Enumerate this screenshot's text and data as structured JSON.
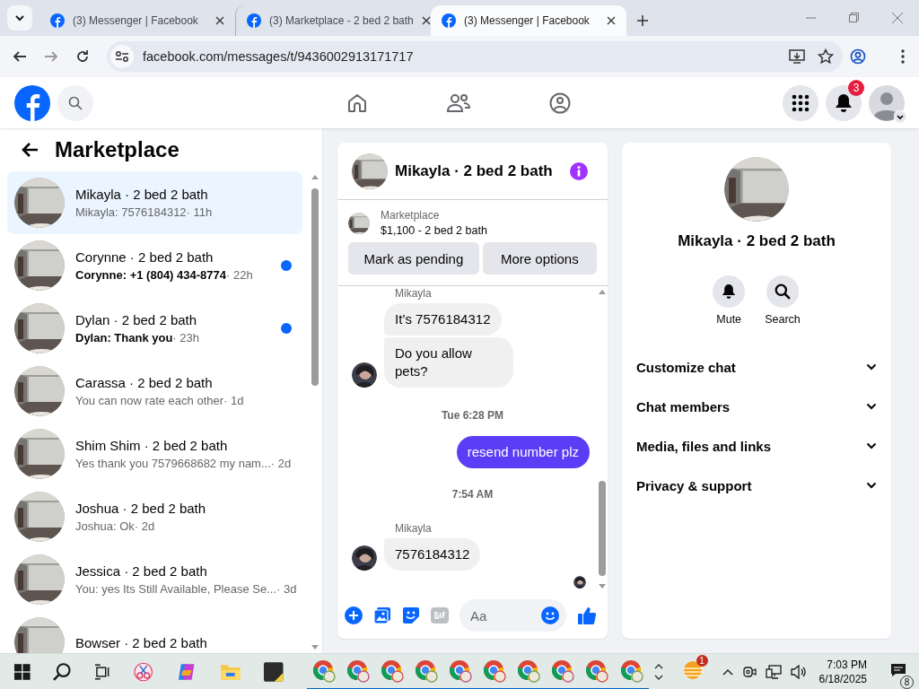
{
  "browser": {
    "tabs": [
      {
        "title": "(3) Messenger | Facebook",
        "selected": false
      },
      {
        "title": "(3) Marketplace - 2 bed 2 bath",
        "selected": false
      },
      {
        "title": "(3) Messenger | Facebook",
        "selected": true
      }
    ],
    "url": "facebook.com/messages/t/9436002913171717"
  },
  "top_nav": {
    "notification_count": "3"
  },
  "sidebar": {
    "title": "Marketplace",
    "conversations": [
      {
        "name": "Mikayla · 2 bed 2 bath",
        "preview": "Mikayla: 7576184312",
        "time": "· 11h",
        "unread": false,
        "selected": true
      },
      {
        "name": "Corynne · 2 bed 2 bath",
        "preview": "Corynne: +1 (804) 434-8774",
        "time": "· 22h",
        "unread": true,
        "selected": false
      },
      {
        "name": "Dylan · 2 bed 2 bath",
        "preview": "Dylan: Thank you",
        "time": "· 23h",
        "unread": true,
        "selected": false
      },
      {
        "name": "Carassa · 2 bed 2 bath",
        "preview": "You can now rate each other",
        "time": "· 1d",
        "unread": false,
        "selected": false
      },
      {
        "name": "Shim Shim · 2 bed 2 bath",
        "preview": "Yes thank you 7579668682 my nam...",
        "time": "· 2d",
        "unread": false,
        "selected": false
      },
      {
        "name": "Joshua · 2 bed 2 bath",
        "preview": "Joshua: Ok",
        "time": "· 2d",
        "unread": false,
        "selected": false
      },
      {
        "name": "Jessica · 2 bed 2 bath",
        "preview": "You: yes Its Still Available, Please Se...",
        "time": "· 3d",
        "unread": false,
        "selected": false
      },
      {
        "name": "Bowser · 2 bed 2 bath",
        "unread": false,
        "selected": false
      }
    ]
  },
  "chat": {
    "title": "Mikayla · 2 bed 2 bath",
    "listing": {
      "label": "Marketplace",
      "title": "$1,100 - 2 bed 2 bath"
    },
    "buttons": [
      "Mark as pending",
      "More options"
    ],
    "messages": [
      {
        "kind": "sender",
        "text": "Mikayla"
      },
      {
        "kind": "incoming",
        "text": "It’s 7576184312",
        "avatar": false
      },
      {
        "kind": "incoming",
        "text": "Do you allow pets?",
        "avatar": true
      },
      {
        "kind": "timestamp",
        "text": "Tue 6:28 PM"
      },
      {
        "kind": "outgoing",
        "text": "resend number plz"
      },
      {
        "kind": "timestamp",
        "text": "7:54 AM"
      },
      {
        "kind": "sender",
        "text": "Mikayla"
      },
      {
        "kind": "incoming",
        "text": "7576184312",
        "avatar": true
      },
      {
        "kind": "seen"
      }
    ],
    "composer": {
      "placeholder": "Aa"
    }
  },
  "info_panel": {
    "title": "Mikayla · 2 bed 2 bath",
    "actions": [
      {
        "kind": "mute",
        "label": "Mute"
      },
      {
        "kind": "search",
        "label": "Search"
      }
    ],
    "sections": [
      {
        "label": "Customize chat",
        "expanded": false
      },
      {
        "label": "Chat members",
        "expanded": false
      },
      {
        "label": "Media, files and links",
        "expanded": false
      },
      {
        "label": "Privacy & support",
        "expanded": false
      }
    ]
  },
  "taskbar": {
    "app_badge": "1",
    "time": "7:03 PM",
    "date": "6/18/2025",
    "notification_count": "8"
  }
}
